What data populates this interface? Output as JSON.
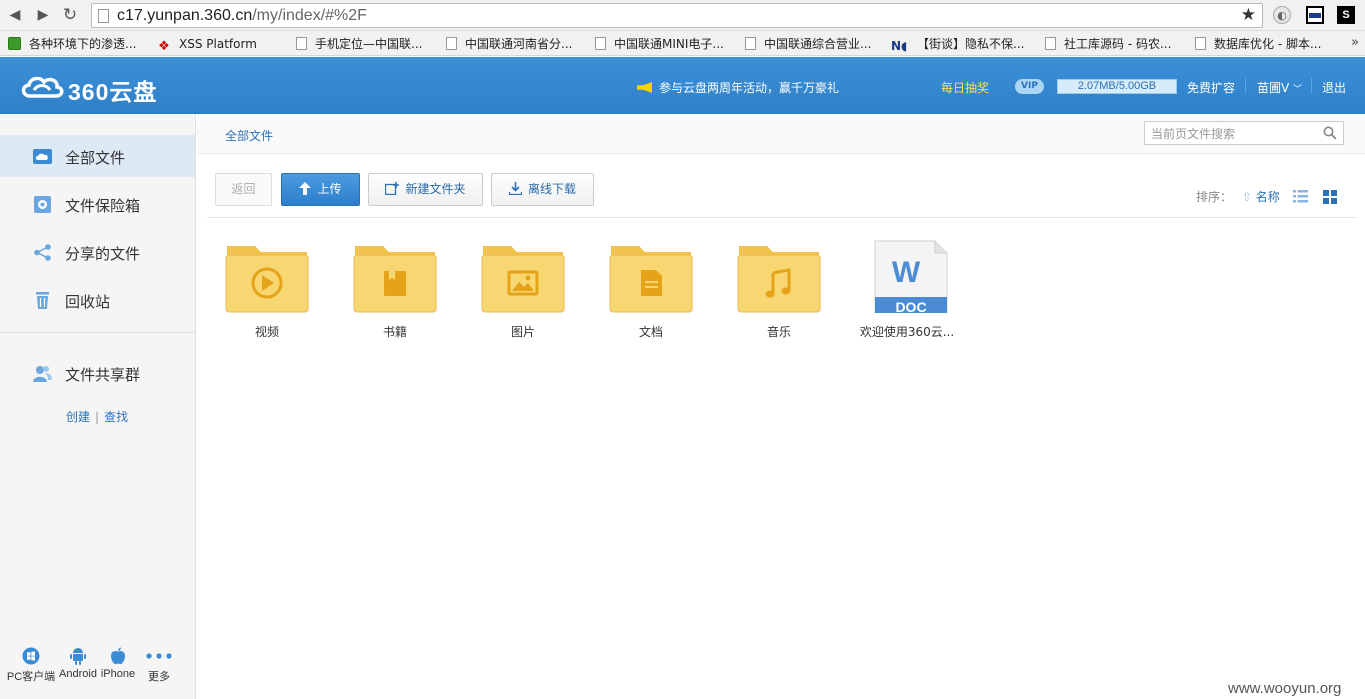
{
  "browser": {
    "url_host": "c17.yunpan.360.cn",
    "url_path": "/my/index/#%2F",
    "bookmarks": [
      "各种环境下的渗透...",
      "XSS Platform",
      "手机定位—中国联...",
      "中国联通河南省分...",
      "中国联通MINI电子...",
      "中国联通综合营业...",
      "【街谈】隐私不保...",
      "社工库源码 - 码农...",
      "数据库优化 - 脚本..."
    ],
    "more": "»"
  },
  "header": {
    "logo_text": "360云盘",
    "promo": "参与云盘两周年活动，赢千万豪礼",
    "lottery": "每日抽奖",
    "vip_badge": "VIP",
    "quota_text": "2.07MB/5.00GB",
    "quota_fraction": 0.0004,
    "expand": "免费扩容",
    "user": "苗圃V",
    "logout": "退出"
  },
  "sidebar": {
    "items": [
      {
        "label": "全部文件"
      },
      {
        "label": "文件保险箱"
      },
      {
        "label": "分享的文件"
      },
      {
        "label": "回收站"
      }
    ],
    "group": {
      "label": "文件共享群",
      "create": "创建",
      "separator": "|",
      "find": "查找"
    },
    "clients": [
      {
        "label": "PC客户端"
      },
      {
        "label": "Android"
      },
      {
        "label": "iPhone"
      },
      {
        "label": "更多"
      }
    ]
  },
  "main": {
    "breadcrumb": "全部文件",
    "search_placeholder": "当前页文件搜索",
    "toolbar": {
      "back": "返回",
      "upload": "上传",
      "new_folder": "新建文件夹",
      "offline": "离线下载",
      "sort_label": "排序：",
      "sort_name": "名称"
    },
    "files": [
      {
        "name": "视频",
        "icon": "video-folder-icon"
      },
      {
        "name": "书籍",
        "icon": "book-folder-icon"
      },
      {
        "name": "图片",
        "icon": "image-folder-icon"
      },
      {
        "name": "文档",
        "icon": "document-folder-icon"
      },
      {
        "name": "音乐",
        "icon": "music-folder-icon"
      },
      {
        "name": "欢迎使用360云...",
        "icon": "word-doc-icon",
        "badge": "DOC",
        "letter": "W"
      }
    ]
  },
  "watermark": "www.wooyun.org",
  "colors": {
    "header_blue": "#2e7fc7",
    "folder_yellow": "#f7d36a",
    "folder_icon": "#e5a318",
    "link_blue": "#2a72b8",
    "doc_blue": "#4a8bd4"
  }
}
